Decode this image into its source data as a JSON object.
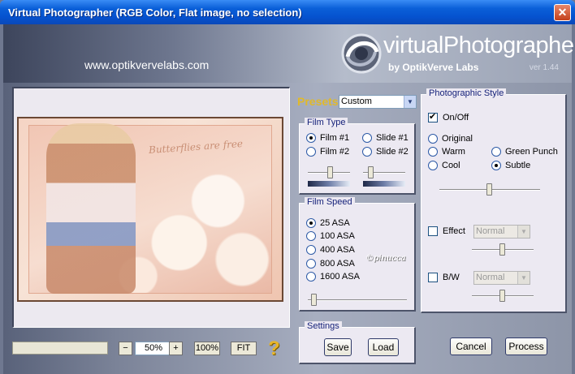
{
  "window": {
    "title": "Virtual Photographer (RGB Color, Flat image, no selection)",
    "close_glyph": "✕"
  },
  "header": {
    "site_url": "www.optikvervelabs.com",
    "logo_text": "virtualPhotographer",
    "logo_sub": "by OptikVerve Labs",
    "version": "ver 1.44"
  },
  "preview": {
    "photo_caption": "Butterflies are free"
  },
  "zoom": {
    "minus": "−",
    "value": "50%",
    "plus": "+",
    "hundred": "100%",
    "fit": "FIT",
    "help": "?"
  },
  "presets": {
    "label": "Presets",
    "value": "Custom",
    "arrow": "▼"
  },
  "film_type": {
    "label": "Film Type",
    "options": [
      "Film #1",
      "Film #2",
      "Slide #1",
      "Slide #2"
    ],
    "selected": "Film #1"
  },
  "film_speed": {
    "label": "Film Speed",
    "options": [
      "25 ASA",
      "100 ASA",
      "400 ASA",
      "800 ASA",
      "1600 ASA"
    ],
    "selected": "25 ASA"
  },
  "photo_style": {
    "label": "Photographic Style",
    "on_off_label": "On/Off",
    "on_off_checked": true,
    "options": [
      "Original",
      "Warm",
      "Cool",
      "Green Punch",
      "Subtle"
    ],
    "selected": "Subtle",
    "effect_label": "Effect",
    "effect_value": "Normal",
    "bw_label": "B/W",
    "bw_value": "Normal",
    "watermark": "©pinucca"
  },
  "settings": {
    "label": "Settings",
    "save": "Save",
    "load": "Load"
  },
  "actions": {
    "cancel": "Cancel",
    "process": "Process"
  },
  "colors": {
    "titlebar": "#0552cf",
    "presets_accent": "#e0b92b",
    "panel_label": "#16227a"
  }
}
